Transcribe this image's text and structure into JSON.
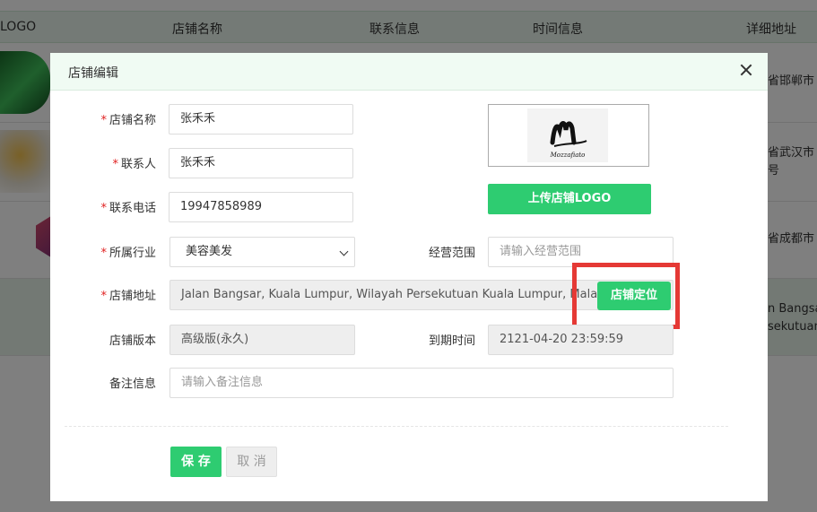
{
  "background": {
    "columns": [
      "LOGO",
      "店铺名称",
      "联系信息",
      "时间信息",
      "详细地址"
    ],
    "rows": [
      {
        "address_lines": [
          "省邯郸市"
        ]
      },
      {
        "address_lines": [
          "省武汉市",
          "号"
        ]
      },
      {
        "address_lines": [
          "省成都市"
        ]
      },
      {
        "address_lines": [
          "n Bangsa",
          "sekutuan "
        ]
      }
    ],
    "colors": {
      "header_bg": "#e9f5ec",
      "highlight_row": "#e6f2e9"
    }
  },
  "dialog": {
    "title": "店铺编辑",
    "close_icon": "close-icon",
    "fields": {
      "shop_name": {
        "label": "店铺名称",
        "required": true,
        "value": "张禾禾"
      },
      "contact": {
        "label": "联系人",
        "required": true,
        "value": "张禾禾"
      },
      "phone": {
        "label": "联系电话",
        "required": true,
        "value": "19947858989"
      },
      "industry": {
        "label": "所属行业",
        "required": true,
        "value": "美容美发"
      },
      "scope": {
        "label": "经营范围",
        "required": false,
        "placeholder": "请输入经营范围"
      },
      "address": {
        "label": "店铺地址",
        "required": true,
        "value": "Jalan Bangsar, Kuala Lumpur, Wilayah Persekutuan Kuala Lumpur, Mala"
      },
      "version": {
        "label": "店铺版本",
        "required": false,
        "value": "高级版(永久)"
      },
      "expiry": {
        "label": "到期时间",
        "required": false,
        "value": "2121-04-20 23:59:59"
      },
      "remark": {
        "label": "备注信息",
        "required": false,
        "placeholder": "请输入备注信息"
      }
    },
    "logo_text": "Mozzafiato",
    "upload_logo_button": "上传店铺LOGO",
    "locate_button": "店铺定位",
    "save_button": "保 存",
    "cancel_button": "取 消",
    "accent_color": "#2ecc71",
    "highlight_color": "#e53935"
  }
}
